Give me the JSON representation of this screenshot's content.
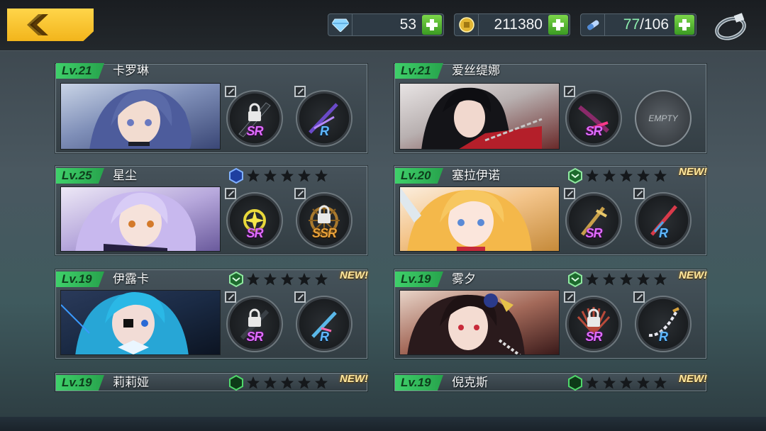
{
  "topbar": {
    "back_label": "",
    "diamonds": "53",
    "coins": "211380",
    "stamina_current": "77",
    "stamina_max": "/106"
  },
  "cards": [
    {
      "level": "Lv.21",
      "name": "卡罗琳",
      "new": "",
      "slot1": "SR",
      "slot2": "R"
    },
    {
      "level": "Lv.21",
      "name": "爱丝缇娜",
      "new": "",
      "slot1": "SR",
      "slot2": "EMPTY"
    },
    {
      "level": "Lv.25",
      "name": "星尘",
      "new": "",
      "slot1": "SR",
      "slot2": "SSR"
    },
    {
      "level": "Lv.20",
      "name": "塞拉伊诺",
      "new": "NEW!",
      "slot1": "SR",
      "slot2": "R"
    },
    {
      "level": "Lv.19",
      "name": "伊露卡",
      "new": "NEW!",
      "slot1": "SR",
      "slot2": "R"
    },
    {
      "level": "Lv.19",
      "name": "雾夕",
      "new": "NEW!",
      "slot1": "SR",
      "slot2": "R"
    },
    {
      "level": "Lv.19",
      "name": "莉莉娅",
      "new": "NEW!"
    },
    {
      "level": "Lv.19",
      "name": "倪克斯",
      "new": "NEW!"
    }
  ],
  "colors": {
    "accent": "#f2b51c",
    "level_green": "#3fd06a",
    "sr": "#e06cff",
    "ssr": "#e8a13a",
    "r": "#5fb8ff"
  },
  "icons": {
    "diamond": "diamond-icon",
    "coin": "coin-icon",
    "stamina": "stamina-icon",
    "ring": "ring-icon"
  }
}
